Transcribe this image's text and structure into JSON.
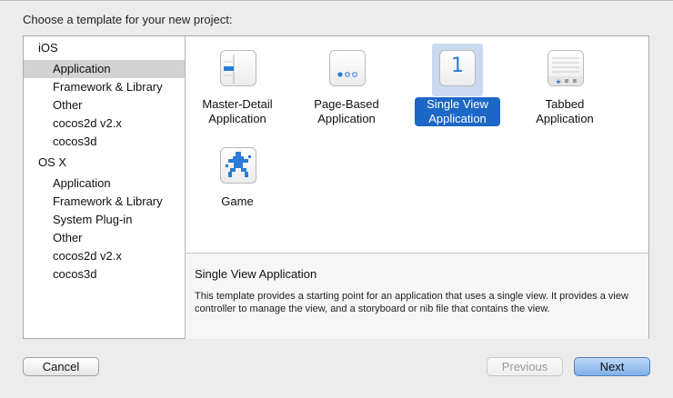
{
  "dialog": {
    "title": "Choose a template for your new project:"
  },
  "sidebar": {
    "sections": [
      {
        "name": "iOS",
        "items": [
          "Application",
          "Framework & Library",
          "Other",
          "cocos2d v2.x",
          "cocos3d"
        ]
      },
      {
        "name": "OS X",
        "items": [
          "Application",
          "Framework & Library",
          "System Plug-in",
          "Other",
          "cocos2d v2.x",
          "cocos3d"
        ]
      }
    ],
    "selected": "iOS / Application"
  },
  "templates": [
    {
      "line1": "Master-Detail",
      "line2": "Application",
      "icon": "master-detail-icon"
    },
    {
      "line1": "Page-Based",
      "line2": "Application",
      "icon": "page-based-icon"
    },
    {
      "line1": "Single View",
      "line2": "Application",
      "icon": "single-view-icon",
      "icon_text": "1",
      "selected": true
    },
    {
      "line1": "Tabbed",
      "line2": "Application",
      "icon": "tabbed-icon"
    },
    {
      "line1": "Game",
      "line2": "",
      "icon": "game-icon"
    }
  ],
  "details": {
    "title": "Single View Application",
    "description": "This template provides a starting point for an application that uses a single view. It provides a view controller to manage the view, and a storyboard or nib file that contains the view."
  },
  "buttons": {
    "cancel": "Cancel",
    "previous": "Previous",
    "next": "Next"
  },
  "colors": {
    "selection_blue": "#1d67c6",
    "selection_tint": "#c9daf0",
    "sidebar_selected": "#d3d3d3"
  }
}
